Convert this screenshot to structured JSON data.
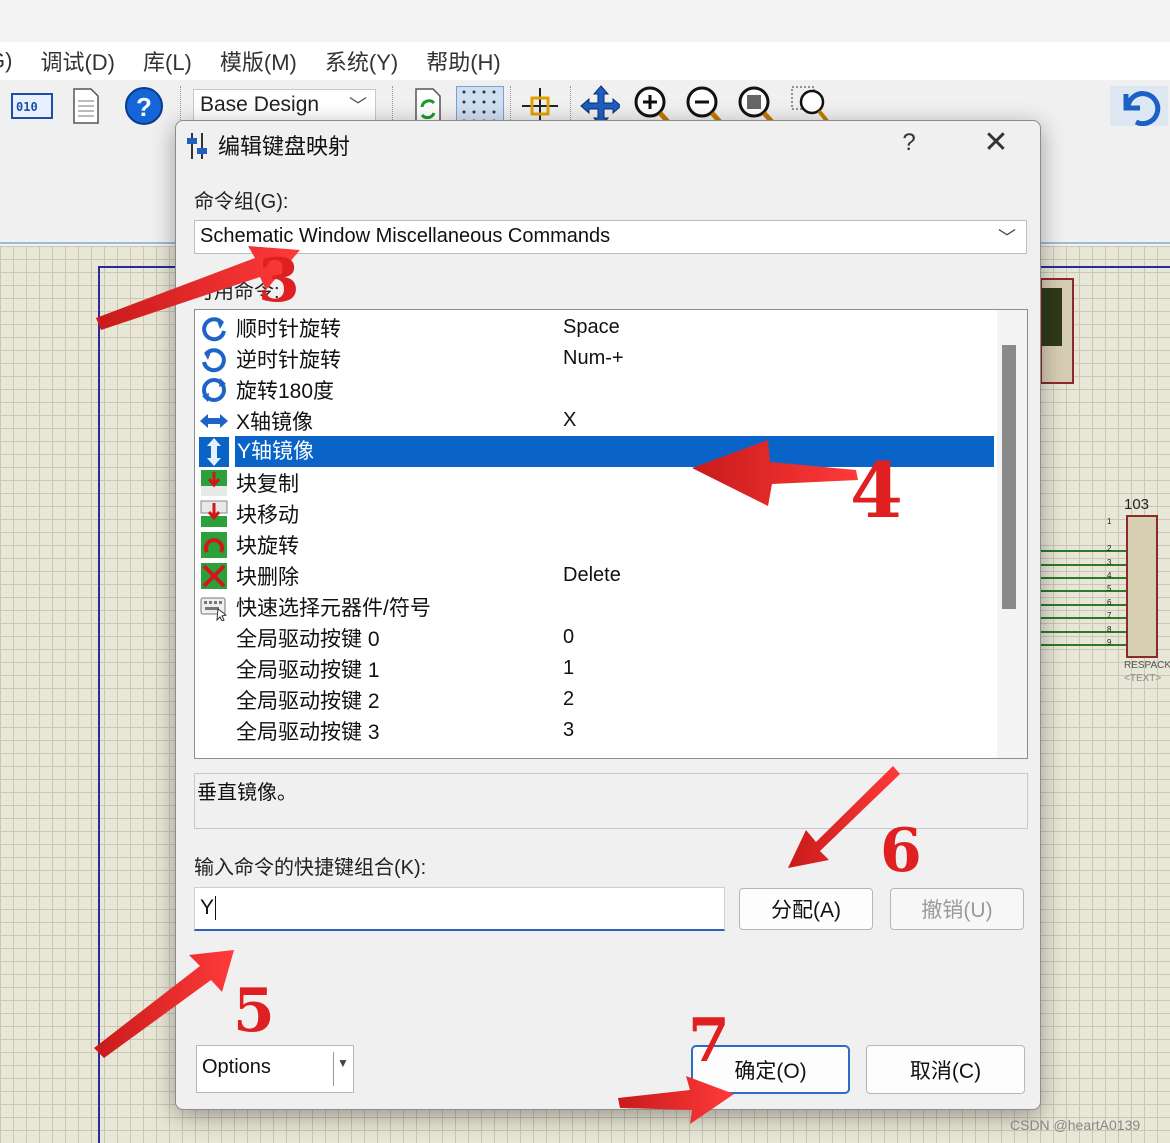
{
  "app": {
    "menu": [
      "G)",
      "调试(D)",
      "库(L)",
      "模版(M)",
      "系统(Y)",
      "帮助(H)"
    ],
    "toolbar": {
      "design_combo": "Base Design",
      "icons": [
        "binary-icon",
        "document-icon",
        "help-icon",
        "refresh-icon",
        "grid-icon",
        "origin-icon",
        "pan-icon",
        "zoom-in-icon",
        "zoom-out-icon",
        "zoom-all-icon",
        "zoom-area-icon",
        "undo-icon"
      ]
    }
  },
  "schematic": {
    "component_ref": "103",
    "component_name": "RESPACK",
    "component_text": "<TEXT>",
    "pins": [
      "1",
      "2",
      "3",
      "4",
      "5",
      "6",
      "7",
      "8",
      "9"
    ]
  },
  "dialog": {
    "title": "编辑键盘映射",
    "help": "?",
    "close": "✕",
    "command_group_label": "命令组(G):",
    "command_group_value": "Schematic Window Miscellaneous Commands",
    "commands_label": "可用命令:",
    "commands": [
      {
        "name": "顺时针旋转",
        "key": "Space",
        "icon": "rotate-cw-icon"
      },
      {
        "name": "逆时针旋转",
        "key": "Num-+",
        "icon": "rotate-ccw-icon"
      },
      {
        "name": "旋转180度",
        "key": "",
        "icon": "rotate-180-icon"
      },
      {
        "name": "X轴镜像",
        "key": "X",
        "icon": "mirror-x-icon"
      },
      {
        "name": "Y轴镜像",
        "key": "",
        "icon": "mirror-y-icon",
        "selected": true
      },
      {
        "name": "块复制",
        "key": "",
        "icon": "block-copy-icon"
      },
      {
        "name": "块移动",
        "key": "",
        "icon": "block-move-icon"
      },
      {
        "name": "块旋转",
        "key": "",
        "icon": "block-rotate-icon"
      },
      {
        "name": "块删除",
        "key": "Delete",
        "icon": "block-delete-icon"
      },
      {
        "name": "快速选择元器件/符号",
        "key": "",
        "icon": "keyboard-pick-icon"
      },
      {
        "name": "全局驱动按键 0",
        "key": "0",
        "icon": ""
      },
      {
        "name": "全局驱动按键 1",
        "key": "1",
        "icon": ""
      },
      {
        "name": "全局驱动按键 2",
        "key": "2",
        "icon": ""
      },
      {
        "name": "全局驱动按键 3",
        "key": "3",
        "icon": ""
      }
    ],
    "description": "垂直镜像。",
    "key_combo_label": "输入命令的快捷键组合(K):",
    "key_combo_value": "Y",
    "assign_button": "分配(A)",
    "revoke_button": "撤销(U)",
    "options_button": "Options",
    "ok_button": "确定(O)",
    "cancel_button": "取消(C)"
  },
  "annotations": {
    "steps": [
      "3",
      "4",
      "5",
      "6",
      "7"
    ],
    "color": "#e02020"
  },
  "watermark": "CSDN @heartA0139"
}
